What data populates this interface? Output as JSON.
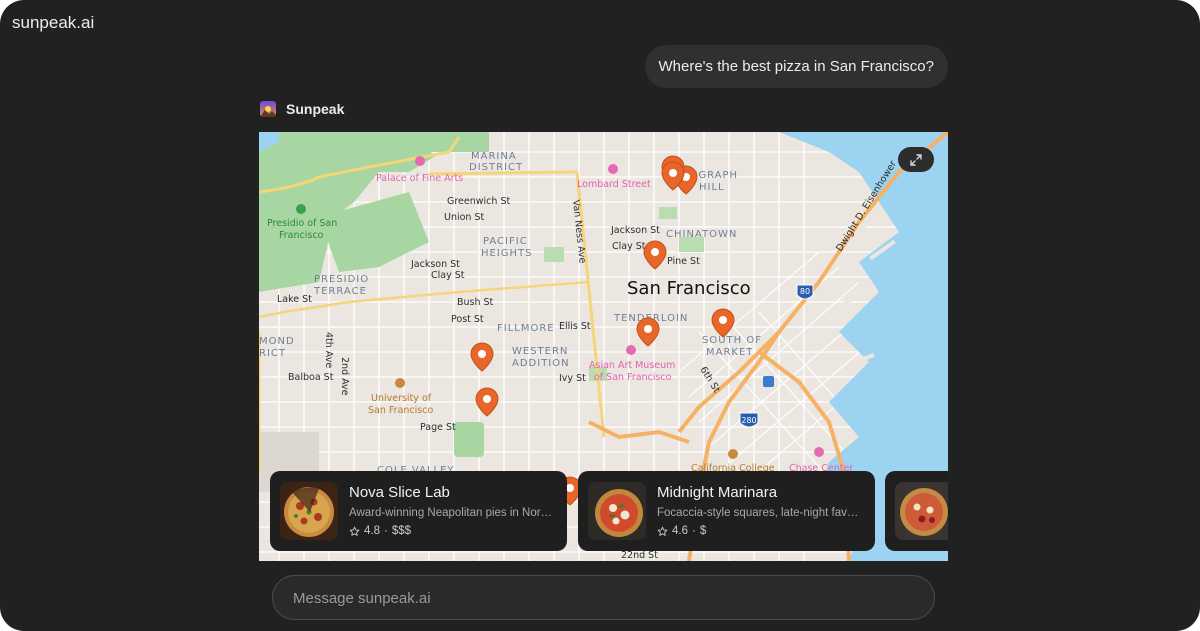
{
  "app": {
    "brand": "sunpeak.ai"
  },
  "chat": {
    "user_message": "Where's the best pizza in San Francisco?",
    "assistant_name": "Sunpeak"
  },
  "map": {
    "city_label": "San Francisco",
    "neighborhoods": [
      "MARINA",
      "DISTRICT",
      "PACIFIC",
      "HEIGHTS",
      "PRESIDIO",
      "TERRACE",
      "FILLMORE",
      "WESTERN",
      "ADDITION",
      "TENDERLOIN",
      "SOUTH OF",
      "MARKET",
      "CHINATOWN",
      "EGRAPH",
      "HILL",
      "COLE VALLEY",
      "MOND",
      "RICT"
    ],
    "streets": [
      "Greenwich St",
      "Union St",
      "Jackson St",
      "Clay St",
      "Jackson St",
      "Clay St",
      "Pine St",
      "Lake St",
      "Bush St",
      "Post St",
      "Ellis St",
      "Balboa St",
      "Ivy St",
      "Page St",
      "Van Ness Ave",
      "Dwight D. Eisenhower",
      "4th Ave",
      "2nd Ave",
      "6th St",
      "22nd St"
    ],
    "pois": [
      "Palace of Fine Arts",
      "Lombard Street",
      "Presidio of San",
      "Francisco",
      "Asian Art Museum",
      "of San Francisco",
      "University of",
      "San Francisco",
      "California College",
      "Chase Center"
    ],
    "highway_shields": [
      "80",
      "280"
    ],
    "colors": {
      "water": "#9bd3f0",
      "park": "#a7d6a2",
      "land": "#ebe6e0",
      "pin": "#e8662a",
      "highway": "#f5b266"
    }
  },
  "places": [
    {
      "name": "Nova Slice Lab",
      "description": "Award-winning Neapolitan pies in North Beach",
      "rating": "4.8",
      "price": "$$$"
    },
    {
      "name": "Midnight Marinara",
      "description": "Focaccia-style squares, late-night favorite",
      "rating": "4.6",
      "price": "$"
    },
    {
      "name": "",
      "description": "",
      "rating": "",
      "price": ""
    }
  ],
  "composer": {
    "placeholder": "Message sunpeak.ai"
  },
  "icons": {
    "expand": "expand-icon",
    "star": "star-icon",
    "avatar": "sunpeak-logo-icon"
  }
}
